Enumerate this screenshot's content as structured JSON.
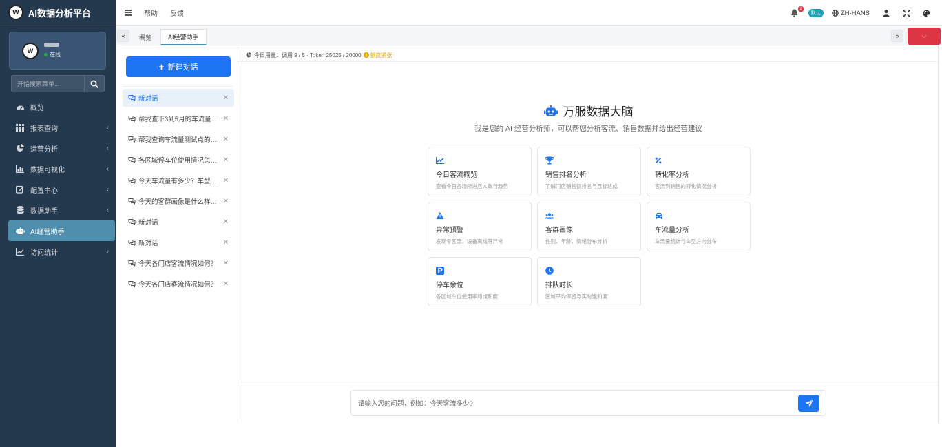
{
  "brand": {
    "title": "AI数据分析平台",
    "logo_icon": "brand-logo-icon"
  },
  "user": {
    "status": "在线"
  },
  "search": {
    "placeholder": "开始搜索菜单..."
  },
  "sidebar": {
    "items": [
      {
        "label": "概览",
        "icon": "dashboard-icon",
        "has_children": false
      },
      {
        "label": "报表查询",
        "icon": "grid-icon",
        "has_children": true
      },
      {
        "label": "运营分析",
        "icon": "pie-chart-icon",
        "has_children": true
      },
      {
        "label": "数据可视化",
        "icon": "bar-chart-icon",
        "has_children": true
      },
      {
        "label": "配置中心",
        "icon": "edit-icon",
        "has_children": true
      },
      {
        "label": "数据助手",
        "icon": "database-icon",
        "has_children": true
      },
      {
        "label": "AI经营助手",
        "icon": "robot-icon",
        "has_children": false,
        "active": true
      },
      {
        "label": "访问统计",
        "icon": "line-chart-icon",
        "has_children": true
      }
    ]
  },
  "topbar": {
    "help": "帮助",
    "feedback": "反馈",
    "notification_count": "2",
    "tag": "默认",
    "language": "ZH-HANS"
  },
  "tabs": {
    "items": [
      {
        "label": "概览"
      },
      {
        "label": "AI经营助手",
        "active": true
      }
    ]
  },
  "chat": {
    "new_button": "新建对话",
    "items": [
      {
        "label": "新对话",
        "active": true
      },
      {
        "label": "帮我查下3到5月的车流量..."
      },
      {
        "label": "帮我查询车流量测试点的数..."
      },
      {
        "label": "各区域停车位使用情况怎么..."
      },
      {
        "label": "今天车流量有多少？车型分..."
      },
      {
        "label": "今天的客群画像是什么样的..."
      },
      {
        "label": "新对话"
      },
      {
        "label": "新对话"
      },
      {
        "label": "今天各门店客流情况如何？"
      },
      {
        "label": "今天各门店客流情况如何？"
      }
    ]
  },
  "usage": {
    "text": "今日用量：调用 9 / 5 · Token 25025 / 20000",
    "warning": "额度紧张"
  },
  "hero": {
    "title": "万服数据大脑",
    "subtitle": "我是您的 AI 经营分析师，可以帮您分析客流、销售数据并给出经营建议"
  },
  "cards": [
    {
      "title": "今日客流概览",
      "desc": "查看今日各场所进店人数与趋势",
      "icon": "trend-icon"
    },
    {
      "title": "销售排名分析",
      "desc": "了解门店销售额排名与目标达成",
      "icon": "trophy-icon"
    },
    {
      "title": "转化率分析",
      "desc": "客流到销售的转化情况分析",
      "icon": "percent-icon"
    },
    {
      "title": "异常预警",
      "desc": "发现零客流、设备离线等异常",
      "icon": "warning-icon"
    },
    {
      "title": "客群画像",
      "desc": "性别、年龄、情绪分布分析",
      "icon": "users-icon"
    },
    {
      "title": "车流量分析",
      "desc": "车流量统计与车型方向分布",
      "icon": "car-icon"
    },
    {
      "title": "停车余位",
      "desc": "各区域车位使用率和饱和度",
      "icon": "parking-icon"
    },
    {
      "title": "排队时长",
      "desc": "区域平均停留与实时饱和度",
      "icon": "clock-icon"
    }
  ],
  "input": {
    "placeholder": "请输入您的问题，例如：今天客流多少?"
  },
  "colors": {
    "sidebar_bg": "#24394e",
    "accent": "#1d74f5",
    "active_nav": "#4f8fad",
    "danger": "#dc3545",
    "warning": "#e0a800"
  }
}
